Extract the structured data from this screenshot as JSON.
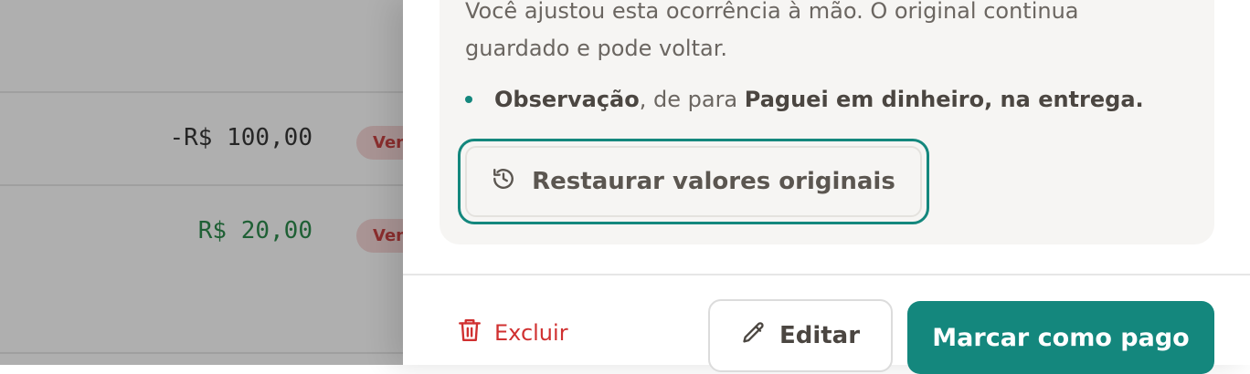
{
  "background_list": {
    "rows": [
      {
        "amount": "-R$ 100,00",
        "badge": "Ven"
      },
      {
        "amount": "R$ 20,00",
        "badge": "Ven"
      }
    ]
  },
  "drawer": {
    "edited_note": {
      "text": "Você ajustou esta ocorrência à mão. O original continua guardado e pode voltar.",
      "change": {
        "field": "Observação",
        "middle": ", de para ",
        "value": "Paguei em dinheiro, na entrega."
      },
      "restore_label": "Restaurar valores originais"
    },
    "footer": {
      "delete_label": "Excluir",
      "edit_label": "Editar",
      "pay_label": "Marcar como pago"
    }
  },
  "colors": {
    "accent": "#14877d",
    "danger": "#d03030",
    "positive": "#17803b",
    "badge_bg": "#f6d4d4"
  }
}
